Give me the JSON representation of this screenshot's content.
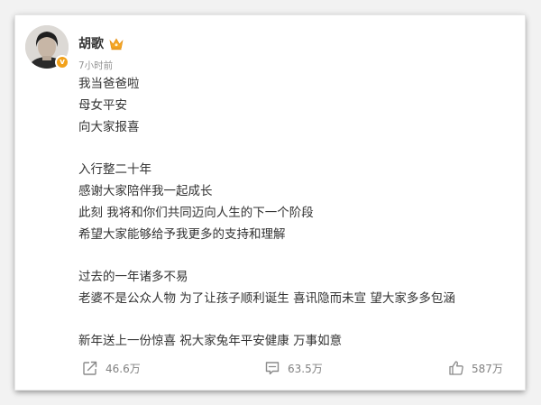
{
  "post": {
    "author": "胡歌",
    "time": "7小时前",
    "lines": [
      "我当爸爸啦",
      "母女平安",
      "向大家报喜",
      "",
      "入行整二十年",
      "感谢大家陪伴我一起成长",
      "此刻 我将和你们共同迈向人生的下一个阶段",
      "希望大家能够给予我更多的支持和理解",
      "",
      "过去的一年诸多不易",
      "老婆不是公众人物 为了让孩子顺利诞生 喜讯隐而未宣 望大家多多包涵",
      "",
      "新年送上一份惊喜 祝大家兔年平安健康 万事如意"
    ],
    "verified_mark": "v"
  },
  "actions": {
    "repost_count": "46.6万",
    "comment_count": "63.5万",
    "like_count": "587万"
  },
  "icons": {
    "crown": "crown-icon",
    "repost": "repost-icon",
    "comment": "comment-icon",
    "like": "thumbs-up-icon"
  },
  "colors": {
    "text": "#333333",
    "meta": "#939393",
    "verified_badge": "#f2a11a",
    "crown": "#f5a623"
  }
}
